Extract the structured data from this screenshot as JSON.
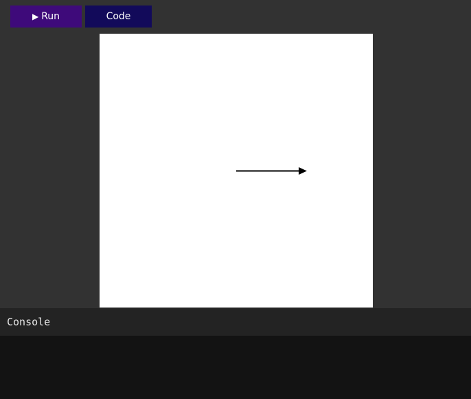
{
  "toolbar": {
    "run_icon": "play-icon",
    "run_icon_glyph": "▶",
    "run_label": "Run",
    "code_label": "Code",
    "run_color": "#3e0a7a",
    "code_color": "#120a5a"
  },
  "canvas": {
    "background": "#ffffff",
    "shape": "arrow",
    "arrow_direction": "right",
    "arrow_color": "#000000"
  },
  "console": {
    "title": "Console",
    "output": ""
  }
}
